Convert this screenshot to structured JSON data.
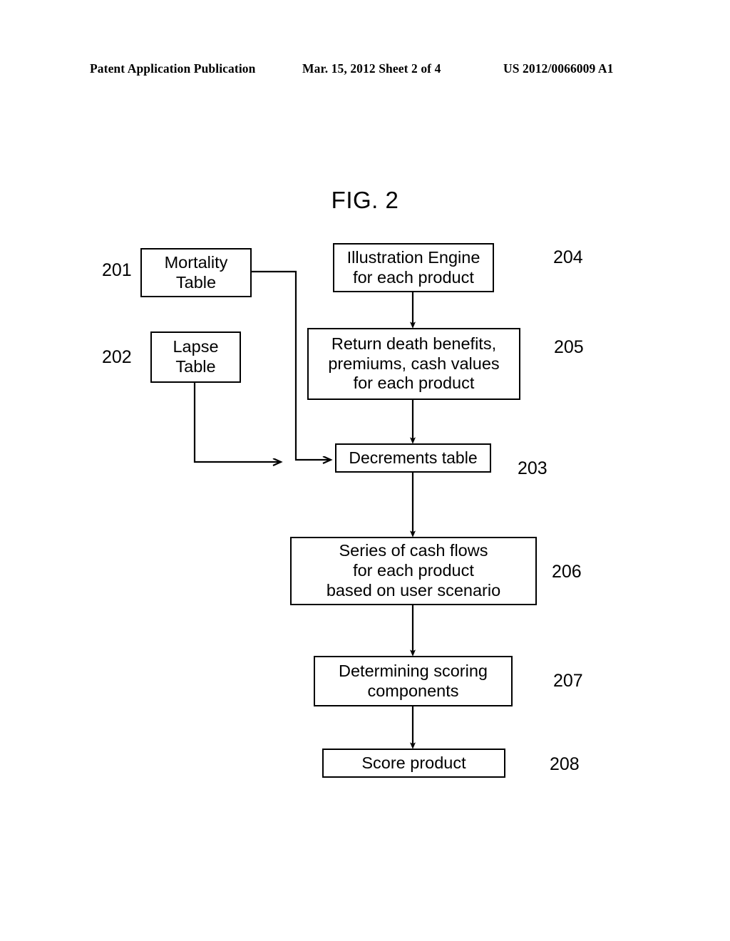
{
  "header": {
    "left": "Patent Application Publication",
    "middle": "Mar. 15, 2012  Sheet 2 of 4",
    "right": "US 2012/0066009 A1"
  },
  "figure": {
    "title": "FIG. 2"
  },
  "nodes": {
    "n201": {
      "ref": "201",
      "line1": "Mortality",
      "line2": "Table"
    },
    "n202": {
      "ref": "202",
      "line1": "Lapse",
      "line2": "Table"
    },
    "n203": {
      "ref": "203",
      "line1": "Decrements table"
    },
    "n204": {
      "ref": "204",
      "line1": "Illustration Engine",
      "line2": "for each product"
    },
    "n205": {
      "ref": "205",
      "line1": "Return death benefits,",
      "line2": "premiums, cash values",
      "line3": "for each product"
    },
    "n206": {
      "ref": "206",
      "line1": "Series of cash flows",
      "line2": "for each product",
      "line3": "based on user scenario"
    },
    "n207": {
      "ref": "207",
      "line1": "Determining scoring",
      "line2": "components"
    },
    "n208": {
      "ref": "208",
      "line1": "Score product"
    }
  },
  "colors": {
    "ink": "#000000",
    "paper": "#ffffff"
  },
  "chart_data": {
    "type": "diagram",
    "title": "FIG. 2",
    "nodes": [
      {
        "id": "201",
        "label": "Mortality Table"
      },
      {
        "id": "202",
        "label": "Lapse Table"
      },
      {
        "id": "203",
        "label": "Decrements table"
      },
      {
        "id": "204",
        "label": "Illustration Engine for each product"
      },
      {
        "id": "205",
        "label": "Return death benefits, premiums, cash values for each product"
      },
      {
        "id": "206",
        "label": "Series of cash flows for each product based on user scenario"
      },
      {
        "id": "207",
        "label": "Determining scoring components"
      },
      {
        "id": "208",
        "label": "Score product"
      }
    ],
    "edges": [
      {
        "from": "201",
        "to": "203"
      },
      {
        "from": "202",
        "to": "203"
      },
      {
        "from": "204",
        "to": "205"
      },
      {
        "from": "205",
        "to": "203"
      },
      {
        "from": "203",
        "to": "206"
      },
      {
        "from": "206",
        "to": "207"
      },
      {
        "from": "207",
        "to": "208"
      }
    ]
  }
}
